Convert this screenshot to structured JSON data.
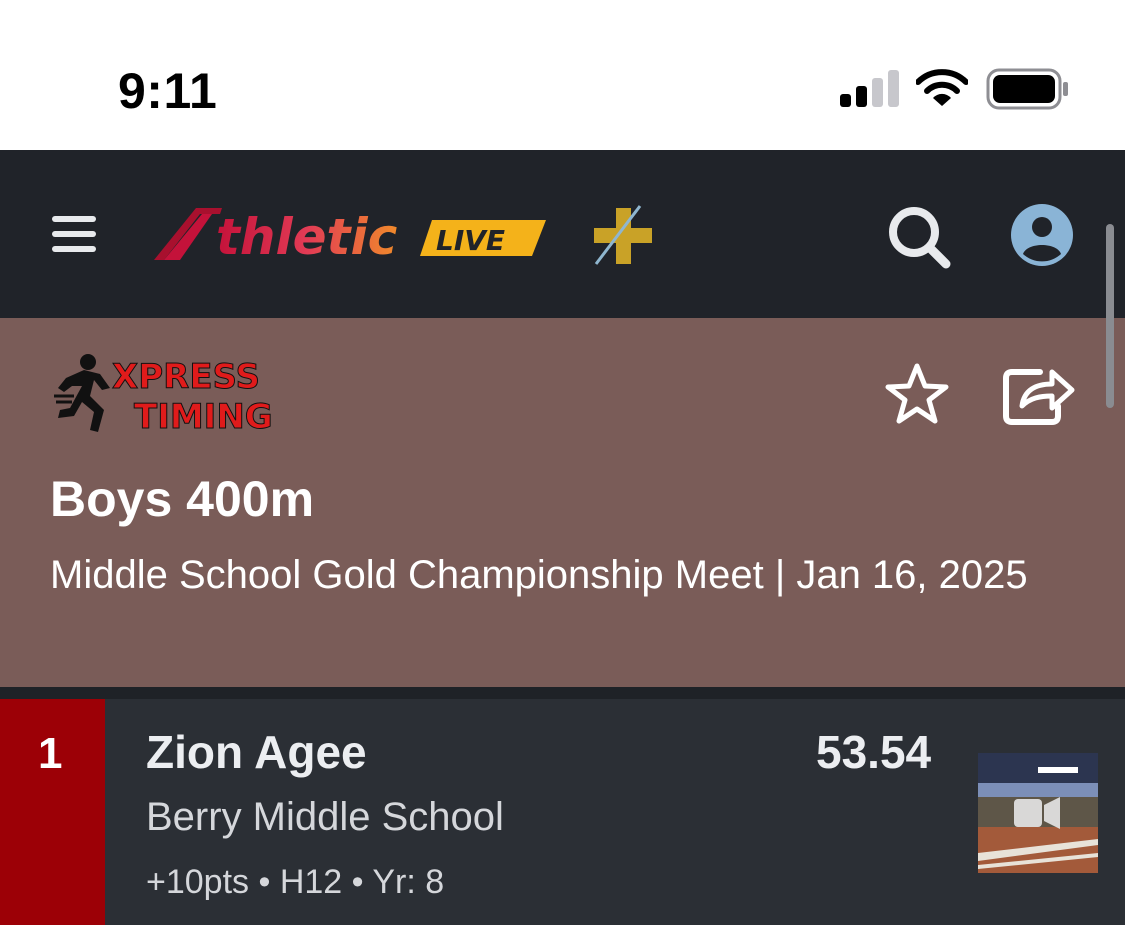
{
  "status_bar": {
    "time": "9:11",
    "signal_icon": "cellular-signal-icon",
    "wifi_icon": "wifi-icon",
    "battery_icon": "battery-icon"
  },
  "navbar": {
    "logo_text": "AthleticLIVE",
    "icons": [
      "menu-icon",
      "plus-logo-icon",
      "search-icon",
      "account-icon"
    ]
  },
  "event": {
    "timer_logo_text": "XPRESS TIMING",
    "title": "Boys 400m",
    "subtitle": "Middle School Gold Championship Meet | Jan 16, 2025",
    "icons": [
      "star-icon",
      "share-icon"
    ]
  },
  "results": [
    {
      "place": "1",
      "athlete": "Zion Agee",
      "school": "Berry Middle School",
      "meta": "+10pts • H12 • Yr: 8",
      "mark": "53.54",
      "video_icon": "video-camera-icon"
    }
  ],
  "colors": {
    "navbar_bg": "#202329",
    "event_header_bg": "#7a5c58",
    "row_bg": "#2b2f35",
    "place_bg": "#9c0006"
  }
}
